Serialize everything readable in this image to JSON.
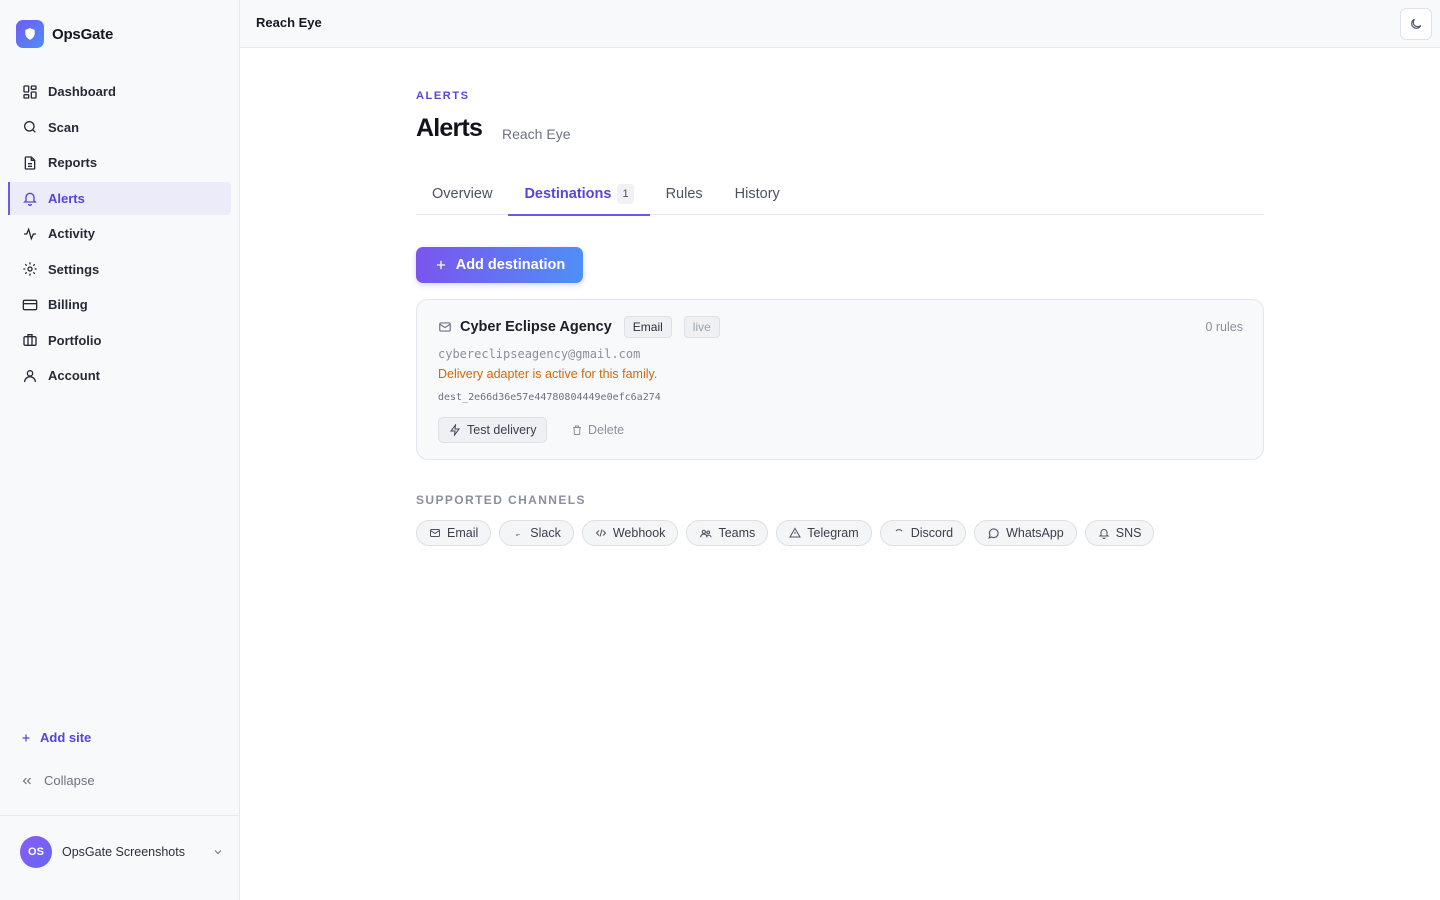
{
  "app": {
    "name": "OpsGate"
  },
  "sidebar": {
    "items": [
      {
        "label": "Dashboard",
        "icon": "dashboard-icon"
      },
      {
        "label": "Scan",
        "icon": "search-icon"
      },
      {
        "label": "Reports",
        "icon": "file-text-icon"
      },
      {
        "label": "Alerts",
        "icon": "bell-icon",
        "active": true
      },
      {
        "label": "Activity",
        "icon": "activity-icon"
      },
      {
        "label": "Settings",
        "icon": "gear-icon"
      },
      {
        "label": "Billing",
        "icon": "credit-card-icon"
      },
      {
        "label": "Portfolio",
        "icon": "briefcase-icon"
      },
      {
        "label": "Account",
        "icon": "user-icon"
      }
    ],
    "add_site": "Add site",
    "collapse": "Collapse",
    "account": {
      "initials": "OS",
      "name": "OpsGate Screenshots"
    }
  },
  "topbar": {
    "title": "Reach Eye"
  },
  "page": {
    "eyebrow": "ALERTS",
    "title": "Alerts",
    "subtitle": "Reach Eye",
    "tabs": [
      {
        "label": "Overview"
      },
      {
        "label": "Destinations",
        "count": "1",
        "active": true
      },
      {
        "label": "Rules"
      },
      {
        "label": "History"
      }
    ],
    "add_button": "Add destination"
  },
  "destination": {
    "name": "Cyber Eclipse Agency",
    "type": "Email",
    "status_chip": "live",
    "rules": "0 rules",
    "email": "cybereclipseagency@gmail.com",
    "status_text": "Delivery adapter is active for this family.",
    "id": "dest_2e66d36e57e44780804449e0efc6a274",
    "test_label": "Test delivery",
    "delete_label": "Delete"
  },
  "channels": {
    "label": "SUPPORTED CHANNELS",
    "items": [
      {
        "label": "Email",
        "icon": "mail-icon"
      },
      {
        "label": "Slack",
        "icon": "slack-icon"
      },
      {
        "label": "Webhook",
        "icon": "code-icon"
      },
      {
        "label": "Teams",
        "icon": "users-icon"
      },
      {
        "label": "Telegram",
        "icon": "send-icon"
      },
      {
        "label": "Discord",
        "icon": "discord-icon"
      },
      {
        "label": "WhatsApp",
        "icon": "chat-icon"
      },
      {
        "label": "SNS",
        "icon": "bell-icon"
      }
    ]
  },
  "colors": {
    "accent": "#5546d9",
    "warning": "#d0680b",
    "sidebar_bg": "#f8f9fb"
  }
}
